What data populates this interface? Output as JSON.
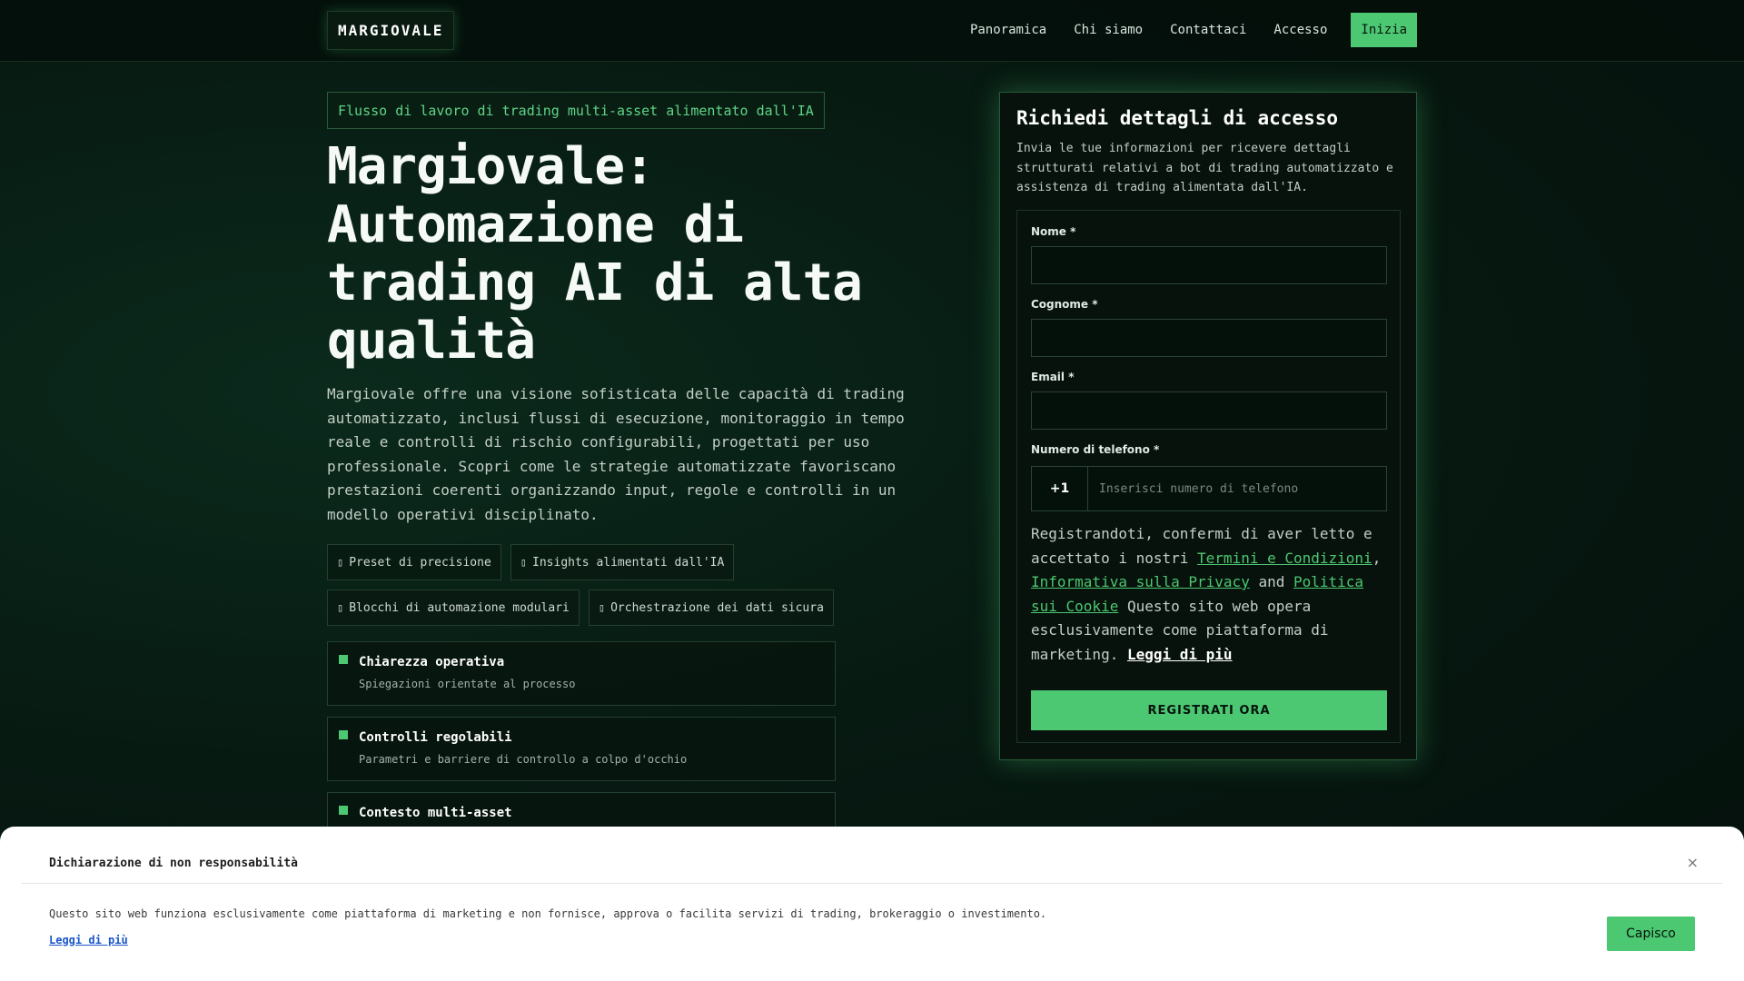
{
  "nav": {
    "logo": "MARGIOVALE",
    "links": [
      "Panoramica",
      "Chi siamo",
      "Contattaci",
      "Accesso"
    ],
    "cta": "Inizia"
  },
  "hero": {
    "tagline": "Flusso di lavoro di trading multi-asset alimentato dall'IA",
    "title": "Margiovale: Automazione di trading AI di alta qualità",
    "description": "Margiovale offre una visione sofisticata delle capacità di trading automatizzato, inclusi flussi di esecuzione, monitoraggio in tempo reale e controlli di rischio configurabili, progettati per uso professionale. Scopri come le strategie automatizzate favoriscano prestazioni coerenti organizzando input, regole e controlli in un modello operativi disciplinato.",
    "chips": [
      {
        "icon": "▯",
        "label": "Preset di precisione"
      },
      {
        "icon": "▯",
        "label": "Insights alimentati dall'IA"
      },
      {
        "icon": "▯",
        "label": "Blocchi di automazione modulari"
      },
      {
        "icon": "▯",
        "label": "Orchestrazione dei dati sicura"
      }
    ],
    "features": [
      {
        "title": "Chiarezza operativa",
        "desc": "Spiegazioni orientate al processo"
      },
      {
        "title": "Controlli regolabili",
        "desc": "Parametri e barriere di controllo a colpo d'occhio"
      },
      {
        "title": "Contesto multi-asset",
        "desc": ""
      }
    ]
  },
  "form": {
    "title": "Richiedi dettagli di accesso",
    "subtitle": "Invia le tue informazioni per ricevere dettagli strutturati relativi a bot di trading automatizzato e assistenza di trading alimentata dall'IA.",
    "first_name_label": "Nome *",
    "last_name_label": "Cognome *",
    "email_label": "Email *",
    "phone_label": "Numero di telefono *",
    "phone_code": "+1",
    "phone_placeholder": "Inserisci numero di telefono",
    "consent_prefix": "Registrandoti, confermi di aver letto e accettato i nostri ",
    "terms_link": "Termini e Condizioni",
    "sep1": ", ",
    "privacy_link": "Informativa sulla Privacy",
    "sep2": " and ",
    "cookie_link": "Politica sui Cookie",
    "consent_suffix": " Questo sito web opera esclusivamente come piattaforma di marketing. ",
    "read_more": "Leggi di più",
    "submit": "REGISTRATI ORA"
  },
  "disclaimer": {
    "title": "Dichiarazione di non responsabilità",
    "close_icon": "×",
    "text": "Questo sito web funziona esclusivamente come piattaforma di marketing e non fornisce, approva o facilita servizi di trading, brokeraggio o investimento.",
    "link": "Leggi di più",
    "button": "Capisco"
  },
  "colors": {
    "accent": "#4cc772",
    "background": "#071a12",
    "card_border": "#2a5a3a",
    "link_blue": "#1b56c9"
  }
}
